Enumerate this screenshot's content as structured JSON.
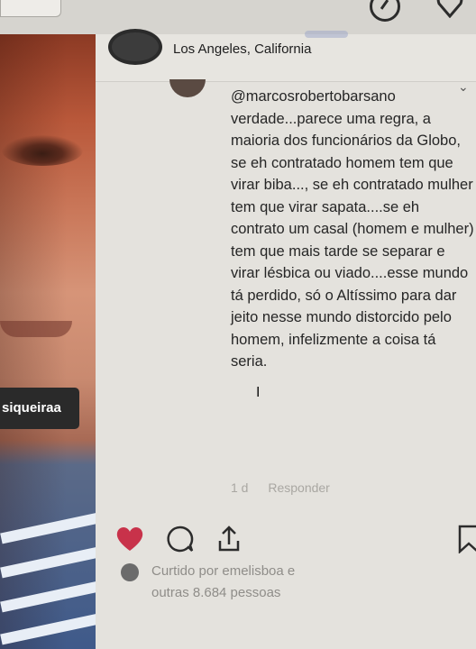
{
  "post": {
    "location": "Los Angeles, California",
    "tag_label": "siqueiraa"
  },
  "comment": {
    "username": "@marcosrobertobarsano",
    "text": "verdade...parece uma regra, a maioria dos funcionários da Globo, se eh contratado homem tem que virar biba..., se eh contratado mulher tem que virar sapata....se eh contrato um casal (homem e mulher) tem que mais tarde se separar e virar lésbica ou viado....esse mundo tá perdido, só o Altíssimo para dar jeito nesse mundo distorcido pelo homem, infelizmente a coisa tá seria.",
    "age": "1 d",
    "reply_label": "Responder"
  },
  "likes": {
    "line1": "Curtido por emelisboa e",
    "line2": "outras 8.684 pessoas"
  },
  "icons": [
    "compass-icon",
    "heart-outline-icon",
    "heart-filled-icon",
    "comment-icon",
    "share-icon",
    "bookmark-icon",
    "chevron-down-icon"
  ],
  "colors": {
    "like_red": "#c8324a",
    "text": "#262626",
    "muted": "#a9a7a2"
  }
}
